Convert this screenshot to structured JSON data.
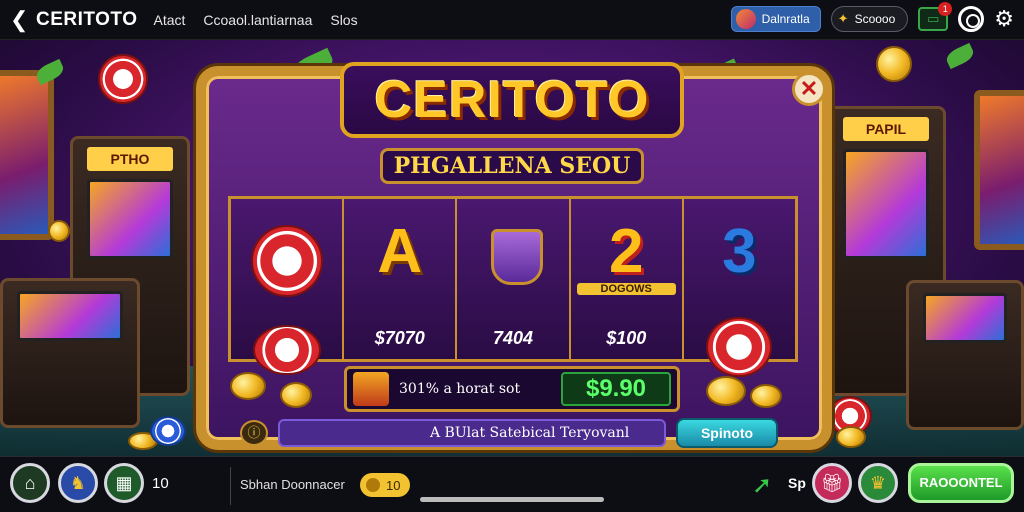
{
  "topbar": {
    "back_icon": "back-chevron-icon",
    "brand": "CERITOTO",
    "nav": [
      "Atact",
      "Ccoaol.lantiarnaa",
      "Slos"
    ],
    "user_label": "Dalnratla",
    "balance": "Scoooo",
    "mail_badge": "1"
  },
  "game": {
    "logo": "CERITOTO",
    "subtitle": "PHGALLENA SEOU",
    "reels": [
      {
        "symbol": "chip",
        "amount": ""
      },
      {
        "symbol": "A",
        "amount": "$7070"
      },
      {
        "symbol": "cup",
        "amount": "7404"
      },
      {
        "symbol": "2",
        "symbol_label": "DOGOWS",
        "amount": "$100"
      },
      {
        "symbol": "3",
        "amount": ""
      }
    ],
    "win_text": "301% a horat sot",
    "win_amount": "$9.90",
    "marquee": "A BUlat Satebical Teryovanl",
    "spin_label": "Spinoto"
  },
  "bottombar": {
    "count": "10",
    "label": "Sbhan Doonnacer",
    "coin_amount": "10",
    "sp_label": "Sp",
    "cta_label": "RAOOONTEL"
  },
  "colors": {
    "frame_gold": "#c9912e",
    "panel_purple": "#4a1670",
    "win_green": "#5aff6a",
    "cta_green": "#1e9a2a"
  }
}
